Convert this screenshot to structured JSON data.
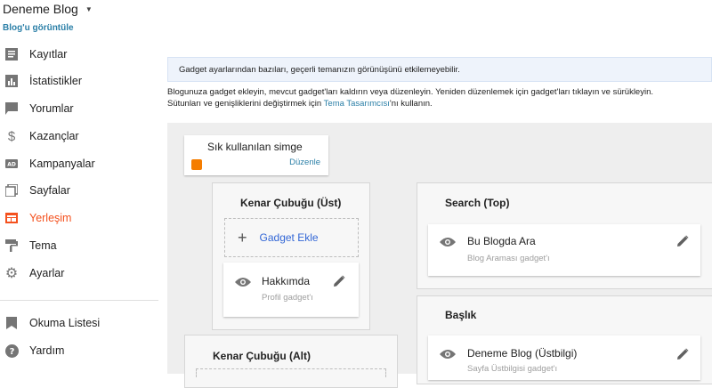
{
  "sidebar": {
    "blog_title": "Deneme Blog",
    "view_blog": "Blog'u görüntüle",
    "items": [
      {
        "label": "Kayıtlar",
        "icon": "posts-icon"
      },
      {
        "label": "İstatistikler",
        "icon": "stats-icon"
      },
      {
        "label": "Yorumlar",
        "icon": "comments-icon"
      },
      {
        "label": "Kazançlar",
        "icon": "dollar-icon"
      },
      {
        "label": "Kampanyalar",
        "icon": "ad-icon"
      },
      {
        "label": "Sayfalar",
        "icon": "pages-icon"
      },
      {
        "label": "Yerleşim",
        "icon": "layout-icon",
        "active": true
      },
      {
        "label": "Tema",
        "icon": "theme-icon"
      },
      {
        "label": "Ayarlar",
        "icon": "settings-icon"
      },
      {
        "label": "Okuma Listesi",
        "icon": "bookmark-icon"
      },
      {
        "label": "Yardım",
        "icon": "help-icon"
      }
    ]
  },
  "main": {
    "notice": "Gadget ayarlarından bazıları, geçerli temanızın görünüşünü etkilemeyebilir.",
    "desc_line1": "Blogunuza gadget ekleyin, mevcut gadget'ları kaldırın veya düzenleyin. Yeniden düzenlemek için gadget'ları tıklayın ve sürükleyin.",
    "desc_line2_pre": "Sütunları ve genişliklerini değiştirmek için ",
    "desc_line2_link": "Tema Tasarımcısı",
    "desc_line2_post": "'nı kullanın.",
    "favicon": {
      "title": "Sık kullanılan simge",
      "edit": "Düzenle"
    },
    "sidebar_top": {
      "title": "Kenar Çubuğu (Üst)",
      "add_gadget": "Gadget Ekle",
      "gadget": {
        "name": "Hakkımda",
        "sub": "Profil gadget'ı"
      }
    },
    "sidebar_bottom": {
      "title": "Kenar Çubuğu (Alt)"
    },
    "search_top": {
      "title": "Search (Top)",
      "gadget": {
        "name": "Bu Blogda Ara",
        "sub": "Blog Araması gadget'ı"
      }
    },
    "header": {
      "title": "Başlık",
      "gadget": {
        "name": "Deneme Blog (Üstbilgi)",
        "sub": "Sayfa Üstbilgisi gadget'ı"
      }
    }
  },
  "colors": {
    "accent": "#f4511e",
    "link": "#2b7fa7",
    "add_gadget": "#3367d6",
    "blogger_orange": "#f57d00"
  }
}
